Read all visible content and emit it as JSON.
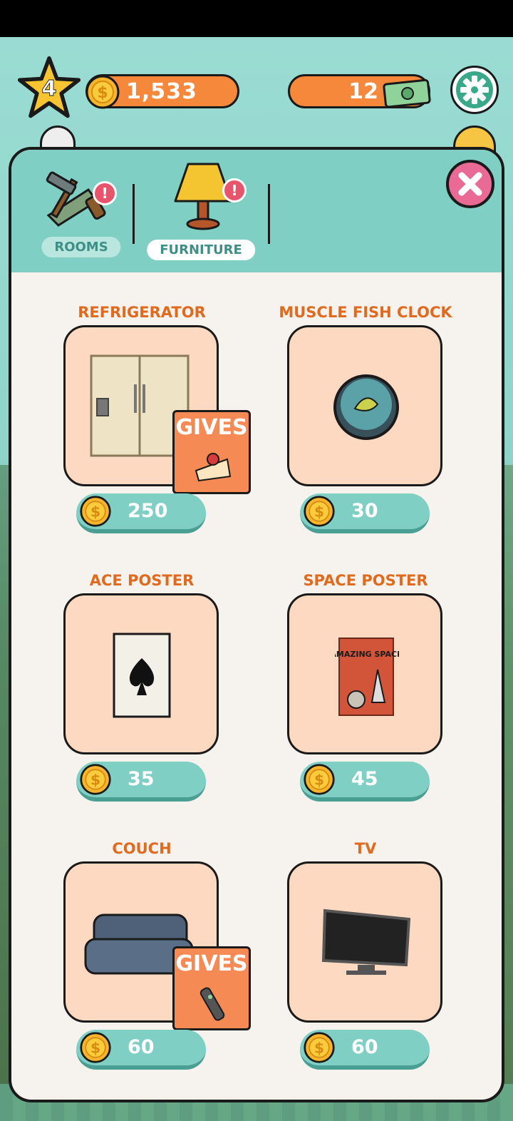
{
  "hud": {
    "level": "4",
    "coins": "1,533",
    "cash": "12"
  },
  "tabs": [
    {
      "label": "ROOMS",
      "alert": "!"
    },
    {
      "label": "FURNITURE",
      "alert": "!"
    }
  ],
  "items": [
    {
      "name": "REFRIGERATOR",
      "price": "250",
      "gives_label": "GIVES"
    },
    {
      "name": "MUSCLE FISH CLOCK",
      "price": "30"
    },
    {
      "name": "ACE POSTER",
      "price": "35"
    },
    {
      "name": "SPACE POSTER",
      "price": "45",
      "poster_text": "AMAZING SPACE"
    },
    {
      "name": "COUCH",
      "price": "60",
      "gives_label": "GIVES"
    },
    {
      "name": "TV",
      "price": "60"
    }
  ],
  "colors": {
    "accent": "#f5883a",
    "teal": "#7fcfc4",
    "title": "#e06a1e",
    "card": "#fdd9c2",
    "close": "#e96a94"
  }
}
